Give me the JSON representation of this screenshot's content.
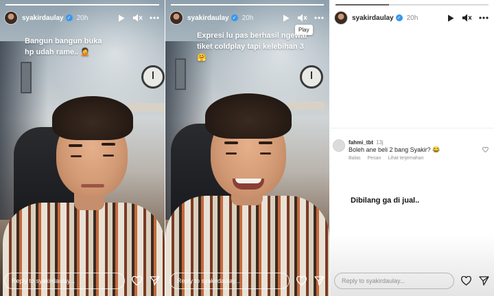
{
  "colors": {
    "verified": "#3897f0",
    "text_light": "#ffffff",
    "text_dark": "#262626",
    "muted": "#8e8e8e"
  },
  "stories": [
    {
      "username": "syakirdaulay",
      "time": "20h",
      "progress": 1.0,
      "caption_line1": "Bangun bangun buka",
      "caption_line2": "hp udah rame.. 🤦",
      "reply_placeholder": "Reply to syakirdaulay..."
    },
    {
      "username": "syakirdaulay",
      "time": "20h",
      "progress": 1.0,
      "tooltip": "Play",
      "caption_line1": "Expresi lu pas berhasil ngewar",
      "caption_line2": "tiket coldplay tapi kelebihan 3 🤗",
      "reply_placeholder": "Reply to syakirdaulay..."
    },
    {
      "username": "syakirdaulay",
      "time": "20h",
      "progress": 0.35,
      "comment": {
        "user": "fahmi_tbt",
        "time": "13j",
        "text": "Boleh ane beli 2 bang Syakir? 😂",
        "actions": [
          "Balas",
          "Pesan",
          "Lihat terjemahan"
        ]
      },
      "body_text": "Dibilang ga di jual..",
      "reply_placeholder": "Reply to syakirdaulay..."
    }
  ],
  "icons": {
    "play": "play-icon",
    "mute": "speaker-muted-icon",
    "more": "more-icon",
    "like": "heart-icon",
    "share": "send-icon"
  }
}
